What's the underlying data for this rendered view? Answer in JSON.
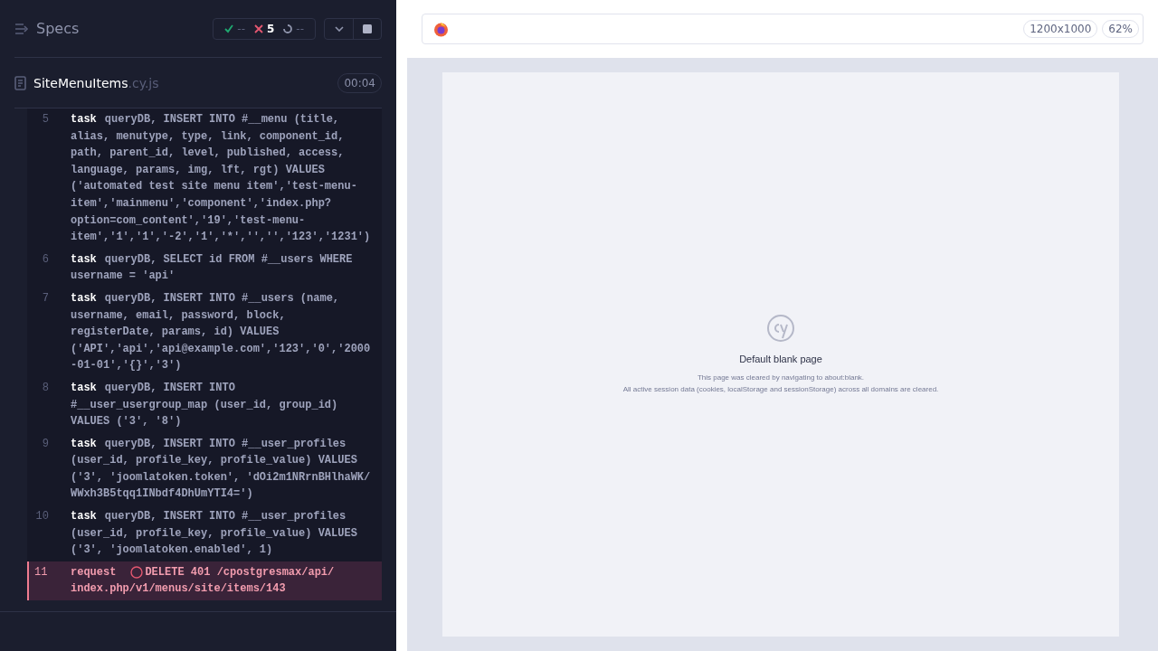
{
  "header": {
    "title": "Specs",
    "stats": {
      "passed": "--",
      "failed": "5",
      "pending": "--"
    }
  },
  "spec": {
    "name": "SiteMenuItems",
    "extension": ".cy.js",
    "duration": "00:04"
  },
  "commands": [
    {
      "number": "5",
      "kind": "task",
      "name": "task",
      "message_lines": [
        "queryDB, INSERT INTO #__menu (title,",
        "alias, menutype, type, link, component_id,",
        "path, parent_id, level, published, access,",
        "language, params, img, lft, rgt) VALUES",
        "('automated test site menu item','test-menu-",
        "item','mainmenu','component','index.php?",
        "option=com_content','19','test-menu-",
        "item','1','1','-2','1','*','','','123','1231')"
      ],
      "failed": false
    },
    {
      "number": "6",
      "kind": "task",
      "name": "task",
      "message_lines": [
        "queryDB, SELECT id FROM #__users WHERE",
        "username = 'api'"
      ],
      "failed": false
    },
    {
      "number": "7",
      "kind": "task",
      "name": "task",
      "message_lines": [
        "queryDB, INSERT INTO #__users (name,",
        "username, email, password, block,",
        "registerDate, params, id) VALUES",
        "('API','api','api@example.com','123','0','2000",
        "-01-01','{}','3')"
      ],
      "failed": false
    },
    {
      "number": "8",
      "kind": "task",
      "name": "task",
      "message_lines": [
        "queryDB, INSERT INTO",
        "#__user_usergroup_map (user_id, group_id)",
        "VALUES ('3', '8')"
      ],
      "failed": false
    },
    {
      "number": "9",
      "kind": "task",
      "name": "task",
      "message_lines": [
        "queryDB, INSERT INTO #__user_profiles",
        "(user_id, profile_key, profile_value) VALUES",
        "('3', 'joomlatoken.token', 'dOi2m1NRrnBHlhaWK/",
        "WWxh3B5tqq1INbdf4DhUmYTI4=')"
      ],
      "failed": false
    },
    {
      "number": "10",
      "kind": "task",
      "name": "task",
      "message_lines": [
        "queryDB, INSERT INTO #__user_profiles",
        "(user_id, profile_key, profile_value) VALUES",
        "('3', 'joomlatoken.enabled', 1)"
      ],
      "failed": false
    },
    {
      "number": "11",
      "kind": "request",
      "name": "request",
      "message_lines": [
        "DELETE 401 /cpostgresmax/api/",
        "index.php/v1/menus/site/items/143"
      ],
      "failed": true
    }
  ],
  "browser": {
    "viewport": "1200x1000",
    "scale": "62%"
  },
  "blank_page": {
    "title": "Default blank page",
    "lines": [
      "This page was cleared by navigating to about:blank.",
      "All active session data (cookies, localStorage and sessionStorage) across all domains are cleared."
    ]
  }
}
